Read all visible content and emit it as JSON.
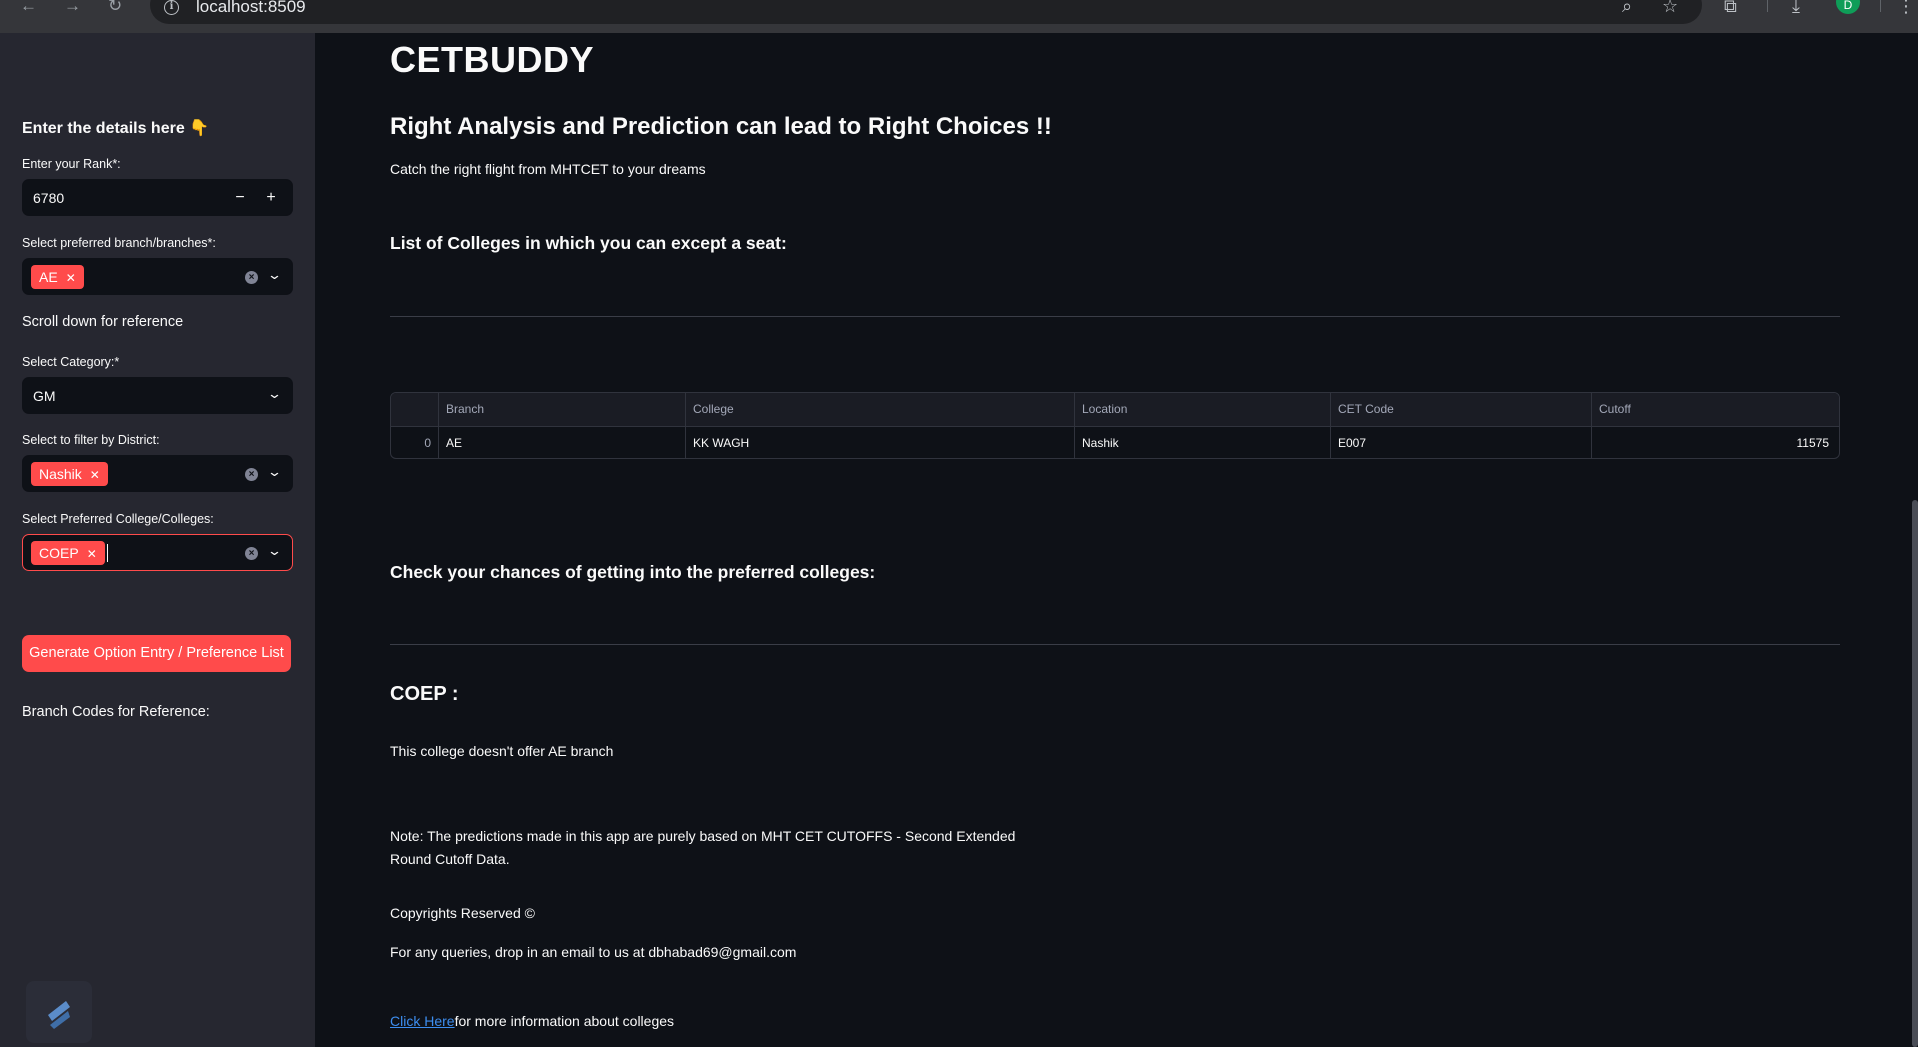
{
  "browser": {
    "url": "localhost:8509",
    "avatar_initial": "D"
  },
  "sidebar": {
    "title": "Enter the details here 👇",
    "rank": {
      "label": "Enter your Rank*:",
      "value": "6780",
      "minus": "−",
      "plus": "+"
    },
    "branch": {
      "label": "Select preferred branch/branches*:",
      "tags": [
        "AE"
      ]
    },
    "scroll_note": "Scroll down for reference",
    "category": {
      "label": "Select Category:*",
      "value": "GM"
    },
    "district": {
      "label": "Select to filter by District:",
      "tags": [
        "Nashik"
      ]
    },
    "college": {
      "label": "Select Preferred College/Colleges:",
      "tags": [
        "COEP"
      ]
    },
    "generate_button": "Generate Option Entry / Preference List",
    "branch_codes_heading": "Branch Codes for Reference:"
  },
  "main": {
    "title": "CETBUDDY",
    "subtitle": "Right Analysis and Prediction can lead to Right Choices !!",
    "tagline": "Catch the right flight from MHTCET to your dreams",
    "list_heading": "List of Colleges in which you can except a seat:",
    "table": {
      "columns": [
        "",
        "Branch",
        "College",
        "Location",
        "CET Code",
        "Cutoff"
      ],
      "rows": [
        [
          "0",
          "AE",
          "KK WAGH",
          "Nashik",
          "E007",
          "11575"
        ]
      ]
    },
    "chances_heading": "Check your chances of getting into the preferred colleges:",
    "coep_heading": "COEP :",
    "coep_message": "This college doesn't offer AE branch",
    "note_line1": "Note: The predictions made in this app are purely based on MHT CET CUTOFFS - Second Extended",
    "note_line2": "Round Cutoff Data.",
    "copyright": "Copyrights Reserved ©",
    "contact": "For any queries, drop in an email to us at dbhabad69@gmail.com",
    "link_text": "Click Here",
    "link_suffix": "for more information about colleges"
  },
  "colors": {
    "primary": "#ff4b4b",
    "background": "#0e1117",
    "sidebar": "#262730",
    "link": "#3d8ef0"
  }
}
